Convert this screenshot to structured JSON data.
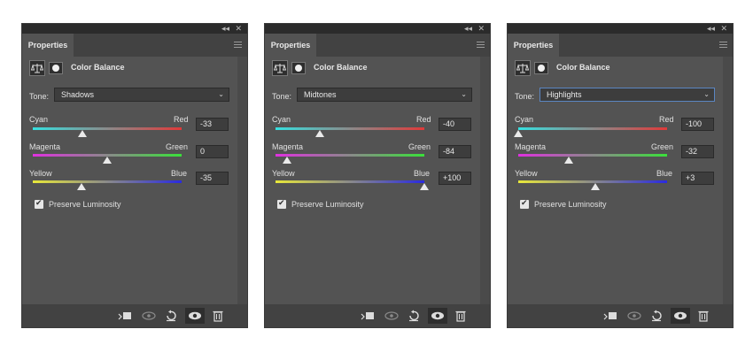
{
  "panel_header": {
    "tab": "Properties",
    "collapse_glyph": "◂◂",
    "close_glyph": "✕"
  },
  "adjustment_name": "Color Balance",
  "tone_label": "Tone:",
  "slider_labels": {
    "cyan": "Cyan",
    "red": "Red",
    "magenta": "Magenta",
    "green": "Green",
    "yellow": "Yellow",
    "blue": "Blue"
  },
  "preserve_luminosity_label": "Preserve Luminosity",
  "colors": {
    "cyan": "#36e0e0",
    "red": "#e03a3a",
    "magenta": "#e030e0",
    "green": "#3ae03a",
    "yellow": "#e8e83a",
    "blue": "#2a2ae0",
    "panel": "#535353",
    "focus": "#5b86c2"
  },
  "panels": [
    {
      "tone": "Shadows",
      "values": {
        "cyan_red": "-33",
        "magenta_green": "0",
        "yellow_blue": "-35"
      },
      "positions": {
        "cyan_red": -33,
        "magenta_green": 0,
        "yellow_blue": -35
      },
      "tone_focused": false
    },
    {
      "tone": "Midtones",
      "values": {
        "cyan_red": "-40",
        "magenta_green": "-84",
        "yellow_blue": "+100"
      },
      "positions": {
        "cyan_red": -40,
        "magenta_green": -84,
        "yellow_blue": 100
      },
      "tone_focused": false
    },
    {
      "tone": "Highlights",
      "values": {
        "cyan_red": "-100",
        "magenta_green": "-32",
        "yellow_blue": "+3"
      },
      "positions": {
        "cyan_red": -100,
        "magenta_green": -32,
        "yellow_blue": 3
      },
      "tone_focused": true
    }
  ],
  "icons": {
    "clip": "clip-to-layer-icon",
    "view_previous": "view-previous-state-icon",
    "reset": "reset-icon",
    "visibility": "eye-icon",
    "delete": "trash-icon",
    "adjustment": "color-balance-scales-icon",
    "mask": "layer-mask-icon"
  }
}
